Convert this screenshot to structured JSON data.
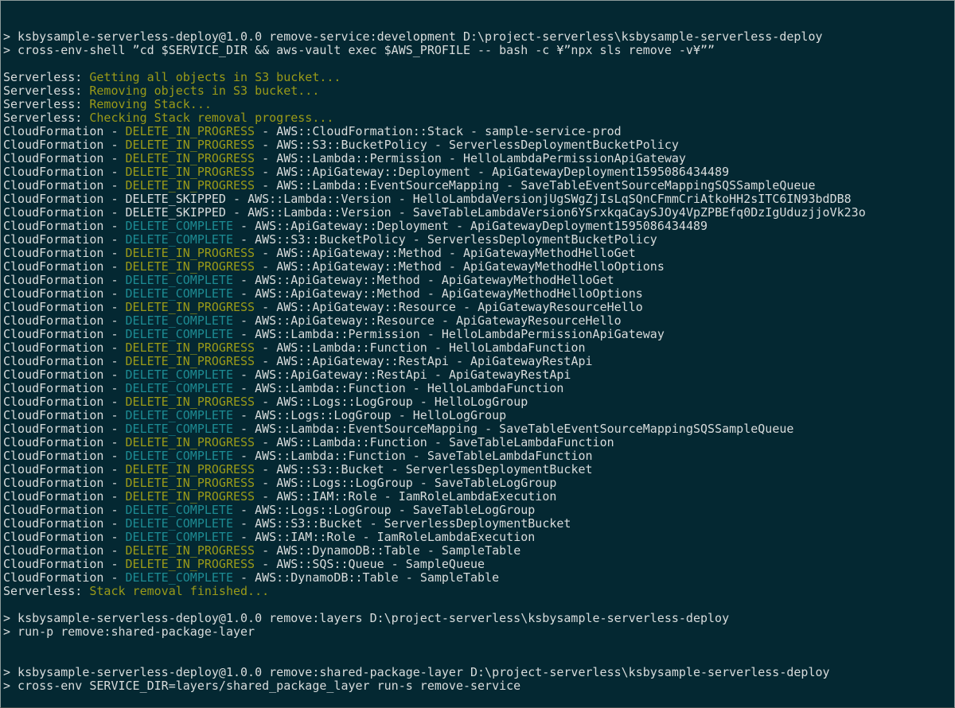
{
  "terminal": {
    "background_color": "#042832",
    "foreground_color": "#d8dcdc",
    "progress_color": "#9a9a18",
    "complete_color": "#1d8b93",
    "title": "npm remove-service terminal output"
  },
  "colors": {
    "white": "#d8dcdc",
    "olive": "#9a9a18",
    "teal": "#1d8b93"
  },
  "lines": [
    {
      "type": "command",
      "text": "> ksbysample-serverless-deploy@1.0.0 remove-service:development D:\\project-serverless\\ksbysample-serverless-deploy"
    },
    {
      "type": "command",
      "text": "> cross-env-shell ”cd $SERVICE_DIR && aws-vault exec $AWS_PROFILE -- bash -c ¥”npx sls remove -v¥””"
    },
    {
      "type": "blank",
      "text": ""
    },
    {
      "type": "serverless",
      "prefix": "Serverless: ",
      "message": "Getting all objects in S3 bucket..."
    },
    {
      "type": "serverless",
      "prefix": "Serverless: ",
      "message": "Removing objects in S3 bucket..."
    },
    {
      "type": "serverless",
      "prefix": "Serverless: ",
      "message": "Removing Stack..."
    },
    {
      "type": "serverless",
      "prefix": "Serverless: ",
      "message": "Checking Stack removal progress..."
    },
    {
      "type": "cfn",
      "source": "CloudFormation",
      "status": "DELETE_IN_PROGRESS",
      "status_color": "olive",
      "resource_type": "AWS::CloudFormation::Stack",
      "logical_id": "sample-service-prod"
    },
    {
      "type": "cfn",
      "source": "CloudFormation",
      "status": "DELETE_IN_PROGRESS",
      "status_color": "olive",
      "resource_type": "AWS::S3::BucketPolicy",
      "logical_id": "ServerlessDeploymentBucketPolicy"
    },
    {
      "type": "cfn",
      "source": "CloudFormation",
      "status": "DELETE_IN_PROGRESS",
      "status_color": "olive",
      "resource_type": "AWS::Lambda::Permission",
      "logical_id": "HelloLambdaPermissionApiGateway"
    },
    {
      "type": "cfn",
      "source": "CloudFormation",
      "status": "DELETE_IN_PROGRESS",
      "status_color": "olive",
      "resource_type": "AWS::ApiGateway::Deployment",
      "logical_id": "ApiGatewayDeployment1595086434489"
    },
    {
      "type": "cfn",
      "source": "CloudFormation",
      "status": "DELETE_IN_PROGRESS",
      "status_color": "olive",
      "resource_type": "AWS::Lambda::EventSourceMapping",
      "logical_id": "SaveTableEventSourceMappingSQSSampleQueue"
    },
    {
      "type": "cfn",
      "source": "CloudFormation",
      "status": "DELETE_SKIPPED",
      "status_color": "white",
      "resource_type": "AWS::Lambda::Version",
      "logical_id": "HelloLambdaVersionjUgSWgZjIsLqSQnCFmmCriAtkoHH2sITC6IN93bdDB8"
    },
    {
      "type": "cfn",
      "source": "CloudFormation",
      "status": "DELETE_SKIPPED",
      "status_color": "white",
      "resource_type": "AWS::Lambda::Version",
      "logical_id": "SaveTableLambdaVersion6YSrxkqaCaySJOy4VpZPBEfq0DzIgUduzjjoVk23o"
    },
    {
      "type": "cfn",
      "source": "CloudFormation",
      "status": "DELETE_COMPLETE",
      "status_color": "teal",
      "resource_type": "AWS::ApiGateway::Deployment",
      "logical_id": "ApiGatewayDeployment1595086434489"
    },
    {
      "type": "cfn",
      "source": "CloudFormation",
      "status": "DELETE_COMPLETE",
      "status_color": "teal",
      "resource_type": "AWS::S3::BucketPolicy",
      "logical_id": "ServerlessDeploymentBucketPolicy"
    },
    {
      "type": "cfn",
      "source": "CloudFormation",
      "status": "DELETE_IN_PROGRESS",
      "status_color": "olive",
      "resource_type": "AWS::ApiGateway::Method",
      "logical_id": "ApiGatewayMethodHelloGet"
    },
    {
      "type": "cfn",
      "source": "CloudFormation",
      "status": "DELETE_IN_PROGRESS",
      "status_color": "olive",
      "resource_type": "AWS::ApiGateway::Method",
      "logical_id": "ApiGatewayMethodHelloOptions"
    },
    {
      "type": "cfn",
      "source": "CloudFormation",
      "status": "DELETE_COMPLETE",
      "status_color": "teal",
      "resource_type": "AWS::ApiGateway::Method",
      "logical_id": "ApiGatewayMethodHelloGet"
    },
    {
      "type": "cfn",
      "source": "CloudFormation",
      "status": "DELETE_COMPLETE",
      "status_color": "teal",
      "resource_type": "AWS::ApiGateway::Method",
      "logical_id": "ApiGatewayMethodHelloOptions"
    },
    {
      "type": "cfn",
      "source": "CloudFormation",
      "status": "DELETE_IN_PROGRESS",
      "status_color": "olive",
      "resource_type": "AWS::ApiGateway::Resource",
      "logical_id": "ApiGatewayResourceHello"
    },
    {
      "type": "cfn",
      "source": "CloudFormation",
      "status": "DELETE_COMPLETE",
      "status_color": "teal",
      "resource_type": "AWS::ApiGateway::Resource",
      "logical_id": "ApiGatewayResourceHello"
    },
    {
      "type": "cfn",
      "source": "CloudFormation",
      "status": "DELETE_COMPLETE",
      "status_color": "teal",
      "resource_type": "AWS::Lambda::Permission",
      "logical_id": "HelloLambdaPermissionApiGateway"
    },
    {
      "type": "cfn",
      "source": "CloudFormation",
      "status": "DELETE_IN_PROGRESS",
      "status_color": "olive",
      "resource_type": "AWS::Lambda::Function",
      "logical_id": "HelloLambdaFunction"
    },
    {
      "type": "cfn",
      "source": "CloudFormation",
      "status": "DELETE_IN_PROGRESS",
      "status_color": "olive",
      "resource_type": "AWS::ApiGateway::RestApi",
      "logical_id": "ApiGatewayRestApi"
    },
    {
      "type": "cfn",
      "source": "CloudFormation",
      "status": "DELETE_COMPLETE",
      "status_color": "teal",
      "resource_type": "AWS::ApiGateway::RestApi",
      "logical_id": "ApiGatewayRestApi"
    },
    {
      "type": "cfn",
      "source": "CloudFormation",
      "status": "DELETE_COMPLETE",
      "status_color": "teal",
      "resource_type": "AWS::Lambda::Function",
      "logical_id": "HelloLambdaFunction"
    },
    {
      "type": "cfn",
      "source": "CloudFormation",
      "status": "DELETE_IN_PROGRESS",
      "status_color": "olive",
      "resource_type": "AWS::Logs::LogGroup",
      "logical_id": "HelloLogGroup"
    },
    {
      "type": "cfn",
      "source": "CloudFormation",
      "status": "DELETE_COMPLETE",
      "status_color": "teal",
      "resource_type": "AWS::Logs::LogGroup",
      "logical_id": "HelloLogGroup"
    },
    {
      "type": "cfn",
      "source": "CloudFormation",
      "status": "DELETE_COMPLETE",
      "status_color": "teal",
      "resource_type": "AWS::Lambda::EventSourceMapping",
      "logical_id": "SaveTableEventSourceMappingSQSSampleQueue"
    },
    {
      "type": "cfn",
      "source": "CloudFormation",
      "status": "DELETE_IN_PROGRESS",
      "status_color": "olive",
      "resource_type": "AWS::Lambda::Function",
      "logical_id": "SaveTableLambdaFunction"
    },
    {
      "type": "cfn",
      "source": "CloudFormation",
      "status": "DELETE_COMPLETE",
      "status_color": "teal",
      "resource_type": "AWS::Lambda::Function",
      "logical_id": "SaveTableLambdaFunction"
    },
    {
      "type": "cfn",
      "source": "CloudFormation",
      "status": "DELETE_IN_PROGRESS",
      "status_color": "olive",
      "resource_type": "AWS::S3::Bucket",
      "logical_id": "ServerlessDeploymentBucket"
    },
    {
      "type": "cfn",
      "source": "CloudFormation",
      "status": "DELETE_IN_PROGRESS",
      "status_color": "olive",
      "resource_type": "AWS::Logs::LogGroup",
      "logical_id": "SaveTableLogGroup"
    },
    {
      "type": "cfn",
      "source": "CloudFormation",
      "status": "DELETE_IN_PROGRESS",
      "status_color": "olive",
      "resource_type": "AWS::IAM::Role",
      "logical_id": "IamRoleLambdaExecution"
    },
    {
      "type": "cfn",
      "source": "CloudFormation",
      "status": "DELETE_COMPLETE",
      "status_color": "teal",
      "resource_type": "AWS::Logs::LogGroup",
      "logical_id": "SaveTableLogGroup"
    },
    {
      "type": "cfn",
      "source": "CloudFormation",
      "status": "DELETE_COMPLETE",
      "status_color": "teal",
      "resource_type": "AWS::S3::Bucket",
      "logical_id": "ServerlessDeploymentBucket"
    },
    {
      "type": "cfn",
      "source": "CloudFormation",
      "status": "DELETE_COMPLETE",
      "status_color": "teal",
      "resource_type": "AWS::IAM::Role",
      "logical_id": "IamRoleLambdaExecution"
    },
    {
      "type": "cfn",
      "source": "CloudFormation",
      "status": "DELETE_IN_PROGRESS",
      "status_color": "olive",
      "resource_type": "AWS::DynamoDB::Table",
      "logical_id": "SampleTable"
    },
    {
      "type": "cfn",
      "source": "CloudFormation",
      "status": "DELETE_IN_PROGRESS",
      "status_color": "olive",
      "resource_type": "AWS::SQS::Queue",
      "logical_id": "SampleQueue"
    },
    {
      "type": "cfn",
      "source": "CloudFormation",
      "status": "DELETE_COMPLETE",
      "status_color": "teal",
      "resource_type": "AWS::DynamoDB::Table",
      "logical_id": "SampleTable"
    },
    {
      "type": "serverless",
      "prefix": "Serverless: ",
      "message": "Stack removal finished..."
    },
    {
      "type": "blank",
      "text": ""
    },
    {
      "type": "command",
      "text": "> ksbysample-serverless-deploy@1.0.0 remove:layers D:\\project-serverless\\ksbysample-serverless-deploy"
    },
    {
      "type": "command",
      "text": "> run-p remove:shared-package-layer"
    },
    {
      "type": "blank",
      "text": ""
    },
    {
      "type": "blank",
      "text": ""
    },
    {
      "type": "command",
      "text": "> ksbysample-serverless-deploy@1.0.0 remove:shared-package-layer D:\\project-serverless\\ksbysample-serverless-deploy"
    },
    {
      "type": "command",
      "text": "> cross-env SERVICE_DIR=layers/shared_package_layer run-s remove-service"
    }
  ]
}
